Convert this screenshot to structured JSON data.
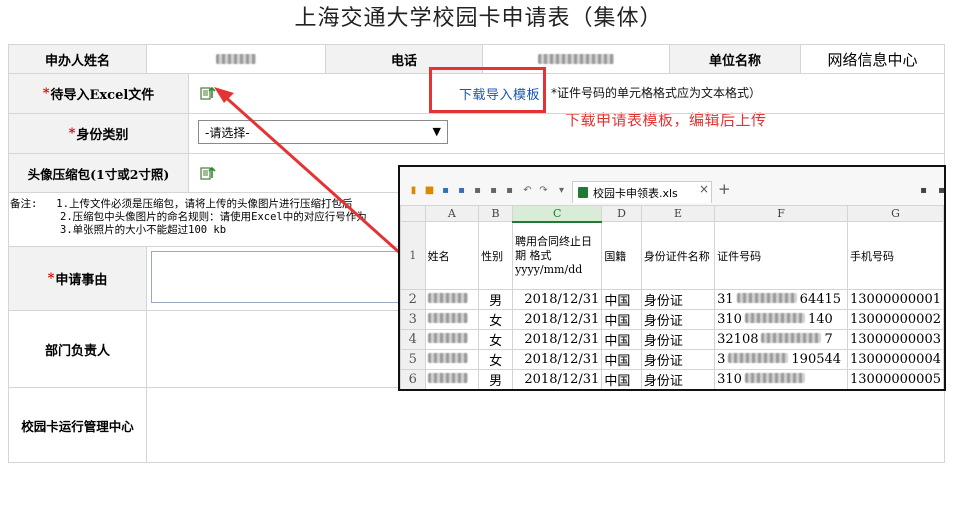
{
  "page": {
    "title": "上海交通大学校园卡申请表（集体）"
  },
  "form": {
    "applicant_label": "申办人姓名",
    "phone_label": "电话",
    "unit_label": "单位名称",
    "unit_value": "网络信息中心",
    "excel_label": "待导入Excel文件",
    "excel_download_link": "下载导入模板",
    "excel_hint": "*证件号码的单元格格式应为文本格式）",
    "identity_label": "身份类别",
    "identity_select": "-请选择-",
    "photo_label": "头像压缩包(1寸或2寸照)",
    "notes_prefix": "备注:",
    "notes": [
      "1.上传文件必须是压缩包，请将上传的头像图片进行压缩打包后",
      "2.压缩包中头像图片的命名规则：请使用Excel中的对应行号作为",
      "3.单张照片的大小不能超过100 kb"
    ],
    "reason_label": "申请事由",
    "dept_head_label": "部门负责人",
    "card_center_label": "校园卡运行管理中心"
  },
  "annotation": {
    "text": "下载申请表模板，编辑后上传",
    "color": "#e53333"
  },
  "spreadsheet": {
    "tab_name": "校园卡申领表.xls",
    "column_letters": [
      "A",
      "B",
      "C",
      "D",
      "E",
      "F",
      "G"
    ],
    "header_row_number": "1",
    "headers": [
      "姓名",
      "性别",
      "聘用合同终止日期 格式yyyy/mm/dd",
      "国籍",
      "身份证件名称",
      "证件号码",
      "手机号码"
    ],
    "rows": [
      {
        "num": "2",
        "gender": "男",
        "date": "2018/12/31",
        "nation": "中国",
        "idtype": "身份证",
        "id_visible": "31",
        "id_tail": "64415",
        "phone": "13000000001"
      },
      {
        "num": "3",
        "gender": "女",
        "date": "2018/12/31",
        "nation": "中国",
        "idtype": "身份证",
        "id_visible": "310",
        "id_tail": "140",
        "phone": "13000000002"
      },
      {
        "num": "4",
        "gender": "女",
        "date": "2018/12/31",
        "nation": "中国",
        "idtype": "身份证",
        "id_visible": "32108",
        "id_tail": "7",
        "phone": "13000000003"
      },
      {
        "num": "5",
        "gender": "女",
        "date": "2018/12/31",
        "nation": "中国",
        "idtype": "身份证",
        "id_visible": "3",
        "id_tail": "190544",
        "phone": "13000000004"
      },
      {
        "num": "6",
        "gender": "男",
        "date": "2018/12/31",
        "nation": "中国",
        "idtype": "身份证",
        "id_visible": "310",
        "id_tail": "",
        "phone": "13000000005"
      }
    ]
  },
  "icons": {
    "upload": "upload-file-icon",
    "select_caret": "▼"
  }
}
